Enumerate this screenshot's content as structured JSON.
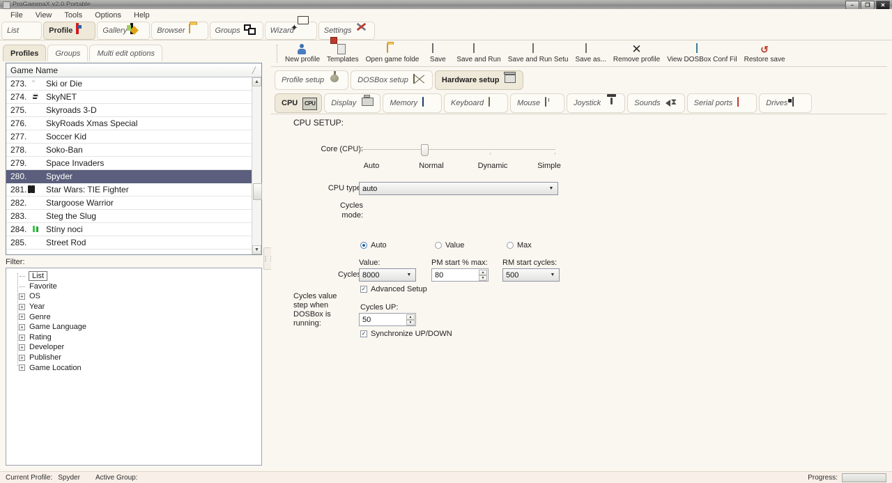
{
  "window": {
    "title": "ProGammaX v2.0 Portable",
    "minimize": "–",
    "maximize": "❐",
    "close": "✕"
  },
  "menubar": {
    "items": [
      "File",
      "View",
      "Tools",
      "Options",
      "Help"
    ]
  },
  "navbar": {
    "items": [
      {
        "label": "List",
        "icon": "target-icon",
        "active": false
      },
      {
        "label": "Profile",
        "icon": "profile-card-icon",
        "active": true
      },
      {
        "label": "Gallery",
        "icon": "gallery-icon",
        "active": false
      },
      {
        "label": "Browser",
        "icon": "folder-icon",
        "active": false
      },
      {
        "label": "Groups",
        "icon": "groups-icon",
        "active": false
      },
      {
        "label": "Wizard",
        "icon": "wizard-icon",
        "active": false
      },
      {
        "label": "Settings",
        "icon": "settings-icon",
        "active": false
      }
    ]
  },
  "subtabs": {
    "items": [
      {
        "label": "Profiles",
        "active": true
      },
      {
        "label": "Groups",
        "active": false
      },
      {
        "label": "Multi edit options",
        "active": false
      }
    ]
  },
  "gamelist": {
    "header": "Game Name",
    "sort_mark": "╱",
    "rows": [
      {
        "num": "273.",
        "name": "Ski or Die",
        "icon": "ski",
        "selected": false
      },
      {
        "num": "274.",
        "name": "SkyNET",
        "icon": "skull",
        "selected": false
      },
      {
        "num": "275.",
        "name": "Skyroads 3-D",
        "icon": "disc",
        "selected": false
      },
      {
        "num": "276.",
        "name": "SkyRoads Xmas Special",
        "icon": "disc",
        "selected": false
      },
      {
        "num": "277.",
        "name": "Soccer Kid",
        "icon": "disc",
        "selected": false
      },
      {
        "num": "278.",
        "name": "Soko-Ban",
        "icon": "disc",
        "selected": false
      },
      {
        "num": "279.",
        "name": "Space Invaders",
        "icon": "disc",
        "selected": false
      },
      {
        "num": "280.",
        "name": "Spyder",
        "icon": "disc",
        "selected": true
      },
      {
        "num": "281.",
        "name": "Star Wars: TIE Fighter",
        "icon": "tie",
        "selected": false
      },
      {
        "num": "282.",
        "name": "Stargoose Warrior",
        "icon": "disc",
        "selected": false
      },
      {
        "num": "283.",
        "name": "Steg the Slug",
        "icon": "disc",
        "selected": false
      },
      {
        "num": "284.",
        "name": "Stíny noci",
        "icon": "green",
        "selected": false
      },
      {
        "num": "285.",
        "name": "Street Rod",
        "icon": "disc",
        "selected": false
      }
    ],
    "scroll_up": "▲",
    "scroll_down": "▼"
  },
  "splitter": {
    "grip": "⋮⋮"
  },
  "filter": {
    "label": "Filter:",
    "nodes": [
      {
        "label": "List",
        "expandable": false,
        "selected": true
      },
      {
        "label": "Favorite",
        "expandable": false,
        "selected": false
      },
      {
        "label": "OS",
        "expandable": true,
        "selected": false
      },
      {
        "label": "Year",
        "expandable": true,
        "selected": false
      },
      {
        "label": "Genre",
        "expandable": true,
        "selected": false
      },
      {
        "label": "Game Language",
        "expandable": true,
        "selected": false
      },
      {
        "label": "Rating",
        "expandable": true,
        "selected": false
      },
      {
        "label": "Developer",
        "expandable": true,
        "selected": false
      },
      {
        "label": "Publisher",
        "expandable": true,
        "selected": false
      },
      {
        "label": "Game Location",
        "expandable": true,
        "selected": false
      }
    ],
    "expander_glyph": "+"
  },
  "right_toolbar": {
    "buttons": [
      {
        "label": "New profile",
        "icon": "new-profile-icon"
      },
      {
        "label": "Templates",
        "icon": "templates-icon"
      },
      {
        "label": "Open game folde",
        "icon": "open-folder-icon"
      },
      {
        "label": "Save",
        "icon": "save-icon"
      },
      {
        "label": "Save and Run",
        "icon": "save-and-run-icon"
      },
      {
        "label": "Save and Run Setu",
        "icon": "save-and-run-setup-icon"
      },
      {
        "label": "Save as...",
        "icon": "save-as-icon"
      },
      {
        "label": "Remove profile",
        "icon": "remove-icon"
      },
      {
        "label": "View DOSBox Conf Fil",
        "icon": "view-conf-icon"
      },
      {
        "label": "Restore save",
        "icon": "restore-save-icon"
      }
    ]
  },
  "setup_tabs": {
    "items": [
      {
        "label": "Profile setup",
        "icon": "tree-icon",
        "active": false
      },
      {
        "label": "DOSBox setup",
        "icon": "box-icon",
        "active": false
      },
      {
        "label": "Hardware setup",
        "icon": "pc-icon",
        "active": true
      }
    ]
  },
  "hardware_tabs": {
    "items": [
      {
        "label": "CPU",
        "icon": "cpu-icon",
        "active": true
      },
      {
        "label": "Display",
        "icon": "display-icon",
        "active": false
      },
      {
        "label": "Memory",
        "icon": "memory-icon",
        "active": false
      },
      {
        "label": "Keyboard",
        "icon": "keyboard-icon",
        "active": false
      },
      {
        "label": "Mouse",
        "icon": "mouse-icon",
        "active": false
      },
      {
        "label": "Joystick",
        "icon": "joystick-icon",
        "active": false
      },
      {
        "label": "Sounds",
        "icon": "sound-icon",
        "active": false
      },
      {
        "label": "Serial ports",
        "icon": "serial-port-icon",
        "active": false
      },
      {
        "label": "Drives",
        "icon": "drive-icon",
        "active": false
      }
    ]
  },
  "cpu_setup": {
    "title": "CPU SETUP:",
    "core_label": "Core (CPU):",
    "core_options": [
      "Auto",
      "Normal",
      "Dynamic",
      "Simple"
    ],
    "core_selected_index": 1,
    "cpu_type_label": "CPU type:",
    "cpu_type_value": "auto",
    "cycles_mode_label_line1": "Cycles",
    "cycles_mode_label_line2": "mode:",
    "cycles_modes": [
      {
        "label": "Auto",
        "selected": true
      },
      {
        "label": "Value",
        "selected": false
      },
      {
        "label": "Max",
        "selected": false
      }
    ],
    "cycles_label": "Cycles:",
    "value_label": "Value:",
    "value_value": "8000",
    "pm_label": "PM start % max:",
    "pm_value": "80",
    "rm_label": "RM start cycles:",
    "rm_value": "500",
    "advanced_setup_label": "Advanced Setup",
    "advanced_setup_checked": true,
    "step_label_lines": [
      "Cycles value",
      "step when",
      "DOSBox is",
      "running:"
    ],
    "cycles_up_label": "Cycles UP:",
    "cycles_up_value": "50",
    "sync_label": "Synchronize UP/DOWN",
    "sync_checked": true,
    "check_glyph": "✓",
    "dropdown_glyph": "▼",
    "spin_up_glyph": "▲",
    "spin_down_glyph": "▼"
  },
  "statusbar": {
    "current_profile_label": "Current Profile:",
    "current_profile_value": "Spyder",
    "active_group_label": "Active Group:",
    "active_group_value": "",
    "progress_label": "Progress:"
  }
}
